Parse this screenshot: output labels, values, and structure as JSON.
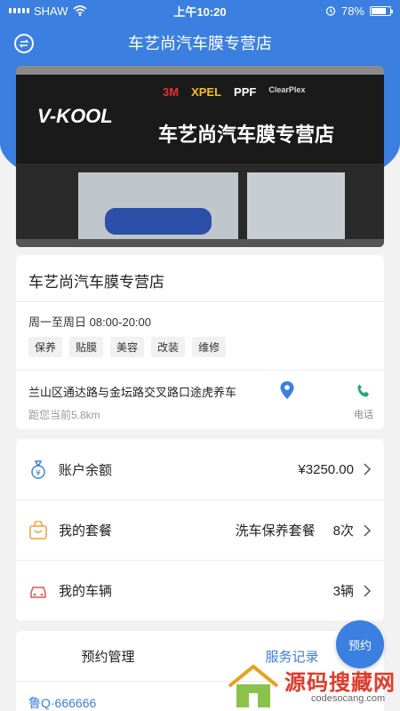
{
  "status_bar": {
    "carrier": "SHAW",
    "time": "上午10:20",
    "battery": "78%"
  },
  "nav": {
    "title": "车艺尚汽车膜专营店"
  },
  "banner": {
    "sign_brand": "V-KOOL",
    "sign_name": "车艺尚汽车膜专营店",
    "sign_logos": [
      "3M",
      "XPEL",
      "PPF",
      "ClearPlex"
    ]
  },
  "shop": {
    "name": "车艺尚汽车膜专营店",
    "hours": "周一至周日 08:00-20:00",
    "tags": [
      "保养",
      "贴膜",
      "美容",
      "改装",
      "维修"
    ],
    "address": "兰山区通达路与金坛路交叉路口途虎养车",
    "distance": "距您当前5.8km",
    "phone_label": "电话"
  },
  "menu": {
    "balance_label": "账户余额",
    "balance_value": "¥3250.00",
    "package_label": "我的套餐",
    "package_name": "洗车保养套餐",
    "package_count": "8次",
    "vehicle_label": "我的车辆",
    "vehicle_count": "3辆"
  },
  "tabs": {
    "items": [
      "预约管理",
      "服务记录"
    ],
    "active": 1
  },
  "plate": "鲁Q·666666",
  "fab_label": "预约",
  "watermark": {
    "text": "源码搜藏网",
    "sub": "codesocang.com"
  },
  "colors": {
    "primary": "#3b7fe0",
    "icon_orange": "#f0a030",
    "icon_red": "#e8504a"
  }
}
